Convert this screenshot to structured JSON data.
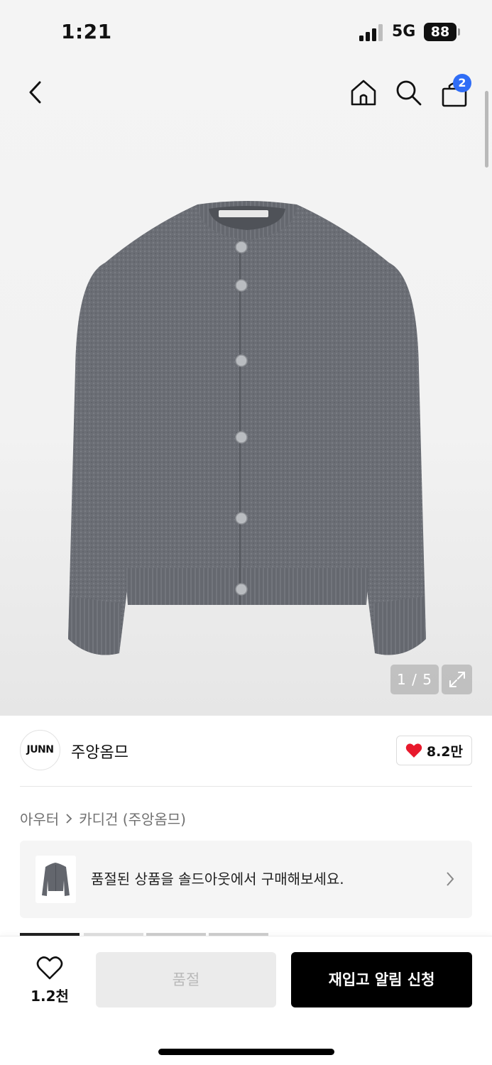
{
  "status": {
    "time": "1:21",
    "network": "5G",
    "battery": "88"
  },
  "nav": {
    "cart_count": "2"
  },
  "gallery": {
    "pager": "1 / 5"
  },
  "brand": {
    "logo_text": "JUNN",
    "name": "주앙옴므",
    "likes": "8.2만"
  },
  "breadcrumb": {
    "items": [
      "아우터",
      "카디건 (주앙옴므)"
    ]
  },
  "banner": {
    "text": "품절된 상품을 솔드아웃에서 구매해보세요."
  },
  "bottom": {
    "wish_count": "1.2천",
    "soldout_label": "품절",
    "restock_label": "재입고 알림 신청"
  },
  "colors": {
    "accent_blue": "#2f6df6",
    "heart_red": "#e8192c",
    "primary_black": "#000000"
  }
}
